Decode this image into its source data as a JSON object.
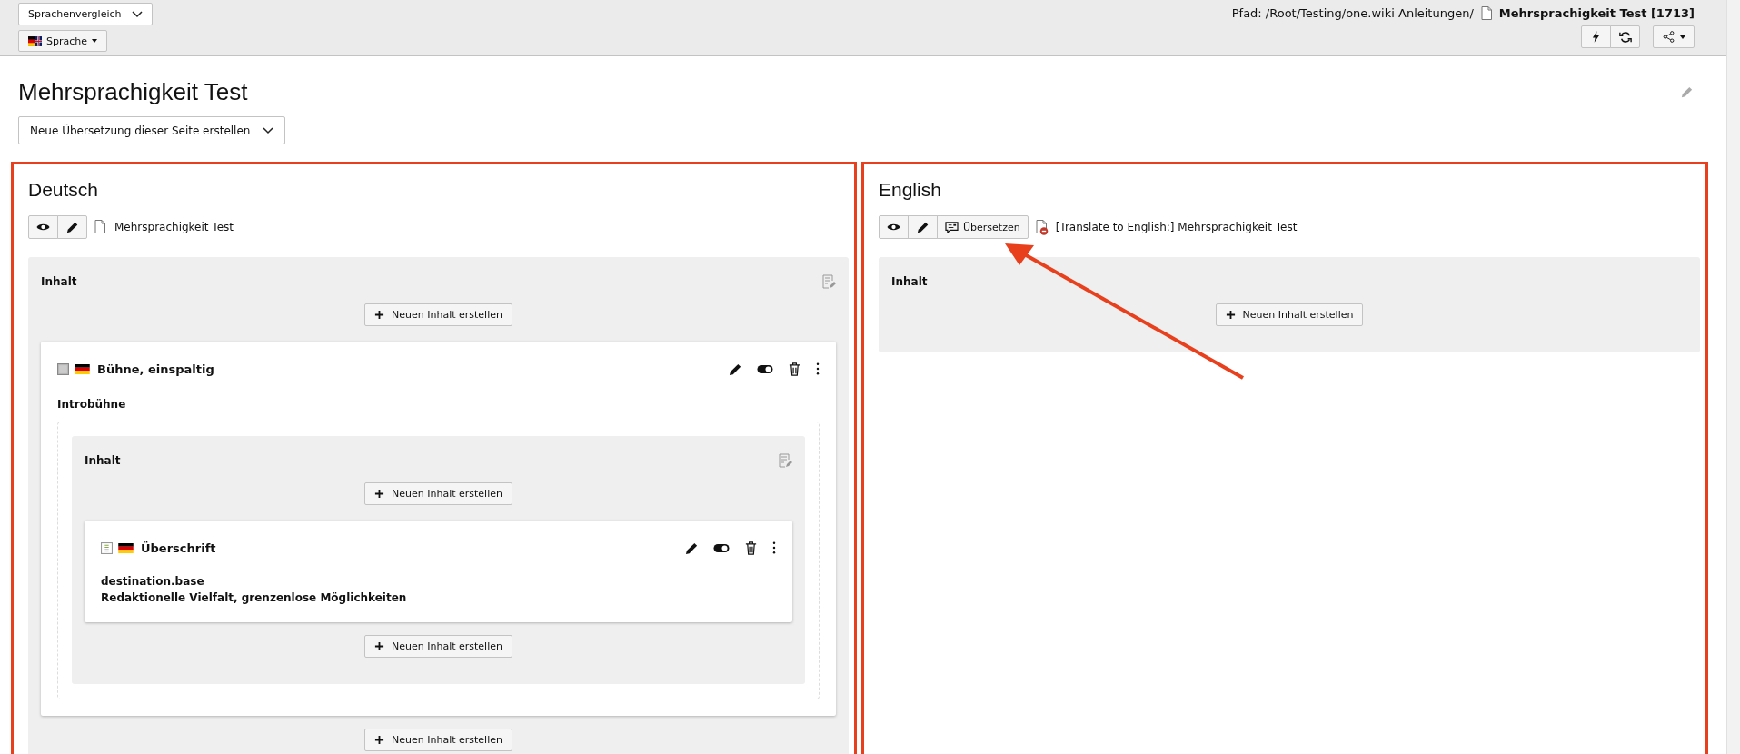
{
  "topbar": {
    "view_select": "Sprachenvergleich",
    "language_button": "Sprache",
    "path_label": "Pfad: /Root/Testing/one.wiki Anleitungen/",
    "page_title": "Mehrsprachigkeit Test [1713]"
  },
  "page": {
    "title": "Mehrsprachigkeit Test",
    "translation_select": "Neue Übersetzung dieser Seite erstellen"
  },
  "columns": [
    {
      "language": "Deutsch",
      "highlighted": true,
      "actions": [
        {
          "kind": "view"
        },
        {
          "kind": "edit"
        }
      ],
      "page_name": "Mehrsprachigkeit Test",
      "translated": true,
      "area": {
        "label": "Inhalt",
        "editable": true,
        "add_label": "Neuen Inhalt erstellen",
        "elements": [
          {
            "kind": "container",
            "title": "Bühne, einspaltig",
            "subtitle": "Introbühne",
            "add_label": "Neuen Inhalt erstellen",
            "areas": [
              {
                "label": "Inhalt",
                "editable": true,
                "add_label": "Neuen Inhalt erstellen",
                "elements": [
                  {
                    "kind": "header",
                    "title": "Überschrift",
                    "lines": [
                      "destination.base",
                      "Redaktionelle Vielfalt, grenzenlose Möglichkeiten"
                    ],
                    "add_label": "Neuen Inhalt erstellen"
                  }
                ]
              }
            ]
          }
        ]
      }
    },
    {
      "language": "English",
      "highlighted": true,
      "actions": [
        {
          "kind": "view"
        },
        {
          "kind": "edit"
        },
        {
          "kind": "translate",
          "label": "Übersetzen"
        }
      ],
      "page_name": "[Translate to English:] Mehrsprachigkeit Test",
      "translated": false,
      "area": {
        "label": "Inhalt",
        "editable": false,
        "add_label": "Neuen Inhalt erstellen"
      }
    }
  ]
}
